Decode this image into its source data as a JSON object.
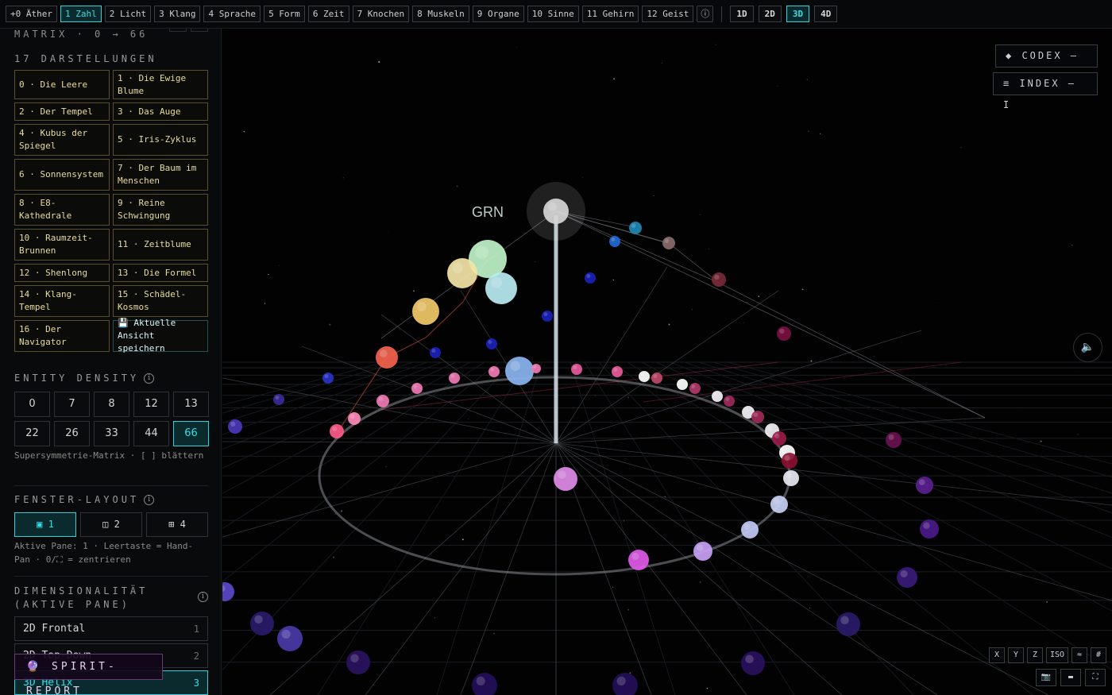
{
  "topbar": {
    "tabs": [
      {
        "label": "+0 Äther",
        "active": false
      },
      {
        "label": "1 Zahl",
        "active": true
      },
      {
        "label": "2 Licht",
        "active": false
      },
      {
        "label": "3 Klang",
        "active": false
      },
      {
        "label": "4 Sprache",
        "active": false
      },
      {
        "label": "5 Form",
        "active": false
      },
      {
        "label": "6 Zeit",
        "active": false
      },
      {
        "label": "7 Knochen",
        "active": false
      },
      {
        "label": "8 Muskeln",
        "active": false
      },
      {
        "label": "9 Organe",
        "active": false
      },
      {
        "label": "10 Sinne",
        "active": false
      },
      {
        "label": "11 Gehirn",
        "active": false
      },
      {
        "label": "12 Geist",
        "active": false
      }
    ],
    "info_glyph": "ⓘ",
    "dims": [
      {
        "label": "1D",
        "active": false
      },
      {
        "label": "2D",
        "active": false
      },
      {
        "label": "3D",
        "active": true
      },
      {
        "label": "4D",
        "active": false
      }
    ]
  },
  "sidebar": {
    "matrix_title": "MATRIX · 0 → 66",
    "representations_title": "17 DARSTELLUNGEN",
    "representations": [
      "0 · Die Leere",
      "1 · Die Ewige Blume",
      "2 · Der Tempel",
      "3 · Das Auge",
      "4 · Kubus der Spiegel",
      "5 · Iris-Zyklus",
      "6 · Sonnensystem",
      "7 · Der Baum im Menschen",
      "8 · E8-Kathedrale",
      "9 · Reine Schwingung",
      "10 · Raumzeit-Brunnen",
      "11 · Zeitblume",
      "12 · Shenlong",
      "13 · Die Formel",
      "14 · Klang-Tempel",
      "15 · Schädel-Kosmos",
      "16 · Der Navigator"
    ],
    "save_view": "💾 Aktuelle Ansicht speichern",
    "density_title": "ENTITY DENSITY",
    "density_options": [
      "0",
      "7",
      "8",
      "12",
      "13",
      "22",
      "26",
      "33",
      "44",
      "66"
    ],
    "density_selected": "66",
    "density_hint": "Supersymmetrie-Matrix · [ ] blättern",
    "layout_title": "FENSTER-LAYOUT",
    "layout_options": [
      {
        "label": "▣ 1",
        "active": true
      },
      {
        "label": "◫ 2",
        "active": false
      },
      {
        "label": "⊞ 4",
        "active": false
      }
    ],
    "layout_hint": "Aktive Pane: 1 · Leertaste = Hand-Pan · 0/⛶ = zentrieren",
    "dimensionality_title": "DIMENSIONALITÄT (AKTIVE PANE)",
    "dimensionality_options": [
      {
        "label": "2D Frontal",
        "key": "1",
        "active": false
      },
      {
        "label": "2D Top-Down",
        "key": "2",
        "active": false
      },
      {
        "label": "3D Helix",
        "key": "3",
        "active": true
      }
    ],
    "spirit_report": "🔮 SPIRIT-REPORT"
  },
  "canvas": {
    "node_label": "GRN",
    "codex_label": "◆ CODEX — C",
    "index_label": "≡ INDEX — I",
    "mute_icon": "🔈",
    "axis_buttons": [
      "X",
      "Y",
      "Z",
      "ISO",
      "≈",
      "#"
    ],
    "tool_buttons": [
      "📷",
      "▬",
      "⛶"
    ],
    "colors": {
      "accent": "#2fe0e8",
      "gold": "#e9dd9a",
      "spirit": "#6a3a78"
    }
  }
}
